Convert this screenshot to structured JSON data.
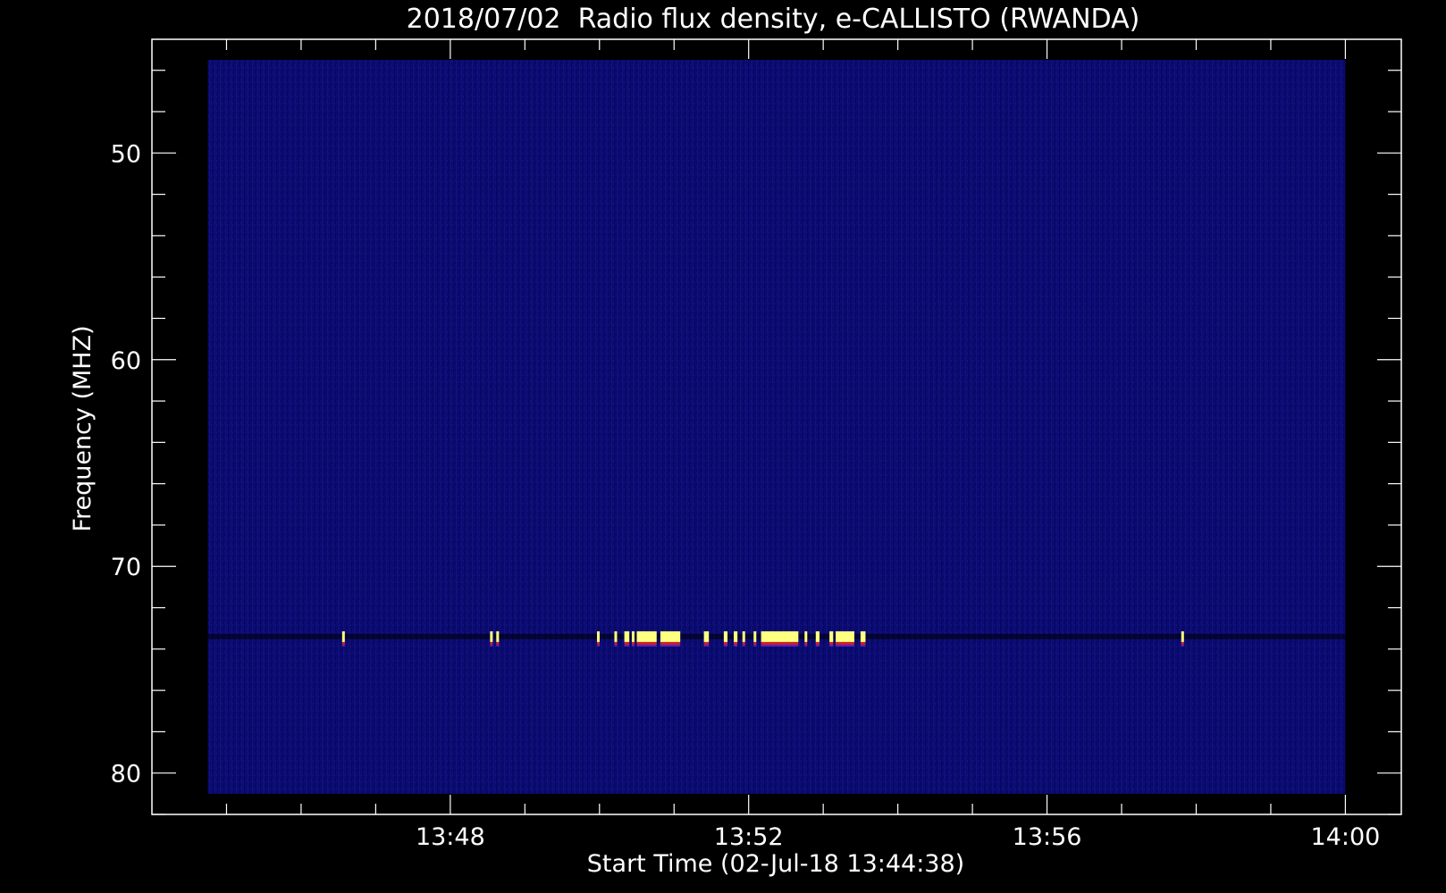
{
  "chart_data": {
    "type": "heatmap",
    "title": "2018/07/02  Radio flux density, e-CALLISTO (RWANDA)",
    "xlabel": "Start Time (02-Jul-18 13:44:38)",
    "ylabel": "Frequency (MHZ)",
    "x_ticks": [
      "13:48",
      "13:52",
      "13:56",
      "14:00"
    ],
    "y_ticks": [
      "50",
      "60",
      "70",
      "80"
    ],
    "xlim": [
      "13:44:00",
      "14:00:45"
    ],
    "ylim": [
      82,
      44.5
    ],
    "data_extent": {
      "x": [
        "13:44:45",
        "14:00:00"
      ],
      "y": [
        81,
        45.5
      ]
    },
    "background_color": "#0a0a6e",
    "burst_color": "#ffff80",
    "burst_frequency_mhz": 73.4,
    "bursts": [
      {
        "start": "13:46:33",
        "end": "13:46:35"
      },
      {
        "start": "13:48:32",
        "end": "13:48:34"
      },
      {
        "start": "13:48:37",
        "end": "13:48:39"
      },
      {
        "start": "13:49:58",
        "end": "13:50:00"
      },
      {
        "start": "13:50:12",
        "end": "13:50:13"
      },
      {
        "start": "13:50:20",
        "end": "13:50:24"
      },
      {
        "start": "13:50:26",
        "end": "13:50:27"
      },
      {
        "start": "13:50:30",
        "end": "13:50:46"
      },
      {
        "start": "13:50:49",
        "end": "13:51:05"
      },
      {
        "start": "13:51:24",
        "end": "13:51:28"
      },
      {
        "start": "13:51:40",
        "end": "13:51:43"
      },
      {
        "start": "13:51:48",
        "end": "13:51:51"
      },
      {
        "start": "13:51:55",
        "end": "13:51:57"
      },
      {
        "start": "13:52:04",
        "end": "13:52:06"
      },
      {
        "start": "13:52:10",
        "end": "13:52:40"
      },
      {
        "start": "13:52:45",
        "end": "13:52:47"
      },
      {
        "start": "13:52:54",
        "end": "13:52:57"
      },
      {
        "start": "13:53:05",
        "end": "13:53:08"
      },
      {
        "start": "13:53:10",
        "end": "13:53:25"
      },
      {
        "start": "13:53:30",
        "end": "13:53:34"
      },
      {
        "start": "13:57:48",
        "end": "13:57:50"
      }
    ]
  }
}
